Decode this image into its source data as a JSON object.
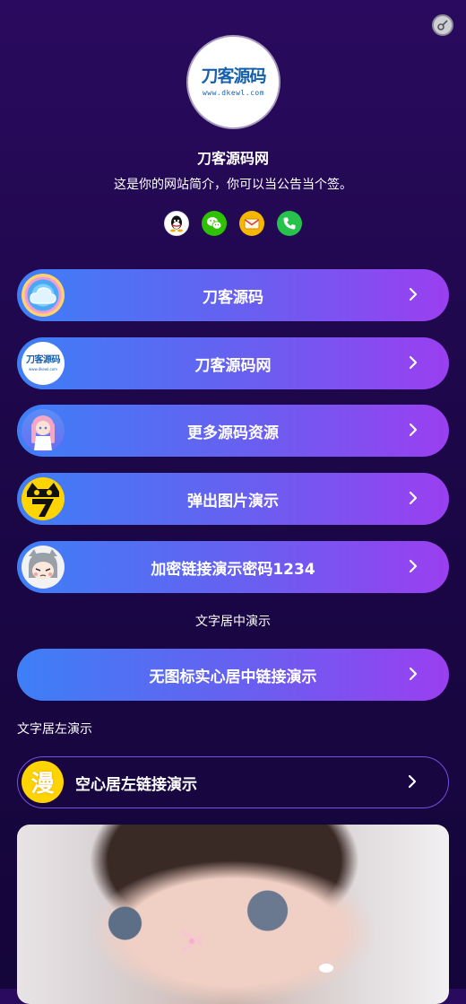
{
  "site": {
    "logo_main": "刀客源码",
    "logo_sub": "www.dkewl.com",
    "title": "刀客源码网",
    "description": "这是你的网站简介，你可以当公告当个签。"
  },
  "socials": [
    "qq-icon",
    "wechat-icon",
    "mail-icon",
    "phone-icon"
  ],
  "links": [
    {
      "label": "刀客源码",
      "icon": "cloud-icon"
    },
    {
      "label": "刀客源码网",
      "icon": "logo-thumb",
      "thumb_text": "刀客源码",
      "thumb_sub": "www.dkewl.com"
    },
    {
      "label": "更多源码资源",
      "icon": "anime-girl-thumb"
    },
    {
      "label": "弹出图片演示",
      "icon": "cat-7-thumb"
    },
    {
      "label": "加密链接演示密码1234",
      "icon": "anime-chibi-thumb"
    }
  ],
  "section_center": "文字居中演示",
  "link_no_icon": {
    "label": "无图标实心居中链接演示"
  },
  "section_left": "文字居左演示",
  "link_hollow": {
    "label": "空心居左链接演示",
    "icon_text": "漫"
  },
  "colors": {
    "bg_top": "#2a0a5e",
    "bg_bottom": "#14053a",
    "grad_start": "#3d7ff6",
    "grad_end": "#9a3ff0",
    "hollow_border": "#7b4fe0"
  }
}
